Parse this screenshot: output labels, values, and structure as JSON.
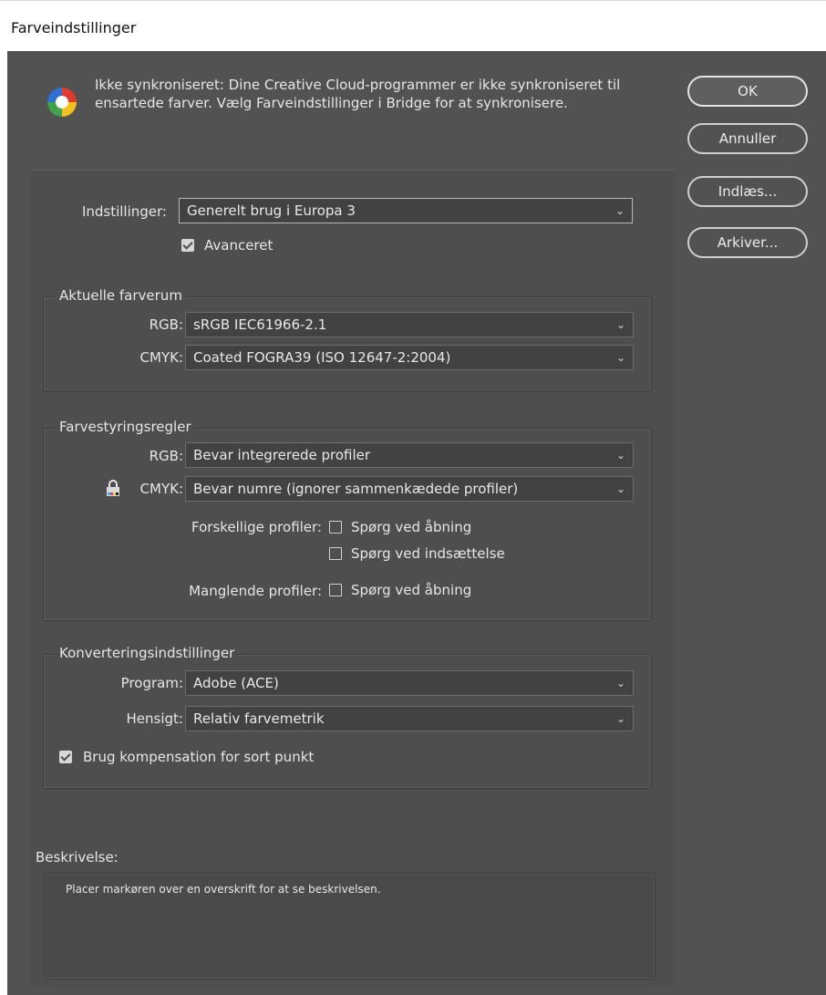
{
  "window": {
    "title": "Farveindstillinger"
  },
  "notice": {
    "line1": "Ikke synkroniseret: Dine Creative Cloud-programmer er ikke synkroniseret til",
    "line2": "ensartede farver. Vælg Farveindstillinger i Bridge for at synkronisere.",
    "icon": "color-sync-icon"
  },
  "buttons": {
    "ok": "OK",
    "cancel": "Annuller",
    "load": "Indlæs...",
    "save": "Arkiver..."
  },
  "settings": {
    "label": "Indstillinger:",
    "value": "Generelt brug i Europa 3",
    "advanced_label": "Avanceret",
    "advanced_checked": true
  },
  "working_spaces": {
    "legend": "Aktuelle farverum",
    "rgb_label": "RGB:",
    "rgb_value": "sRGB IEC61966-2.1",
    "cmyk_label": "CMYK:",
    "cmyk_value": "Coated FOGRA39 (ISO 12647-2:2004)"
  },
  "policies": {
    "legend": "Farvestyringsregler",
    "rgb_label": "RGB:",
    "rgb_value": "Bevar integrerede profiler",
    "cmyk_label": "CMYK:",
    "cmyk_value": "Bevar numre (ignorer sammenkædede profiler)",
    "lock_icon": "lock-icon",
    "mismatch_label": "Forskellige profiler:",
    "ask_open_label": "Spørg ved åbning",
    "ask_paste_label": "Spørg ved indsættelse",
    "missing_label": "Manglende profiler:",
    "missing_ask_open_label": "Spørg ved åbning"
  },
  "conversion": {
    "legend": "Konverteringsindstillinger",
    "engine_label": "Program:",
    "engine_value": "Adobe (ACE)",
    "intent_label": "Hensigt:",
    "intent_value": "Relativ farvemetrik",
    "bpc_label": "Brug kompensation for sort punkt",
    "bpc_checked": true
  },
  "description": {
    "label": "Beskrivelse:",
    "text": "Placer markøren over en overskrift for at se beskrivelsen."
  },
  "colors": {
    "dialog_bg": "#525252",
    "panel_bg": "#4e4e4e",
    "field_bg": "#424242",
    "text": "#e6e6e6"
  }
}
